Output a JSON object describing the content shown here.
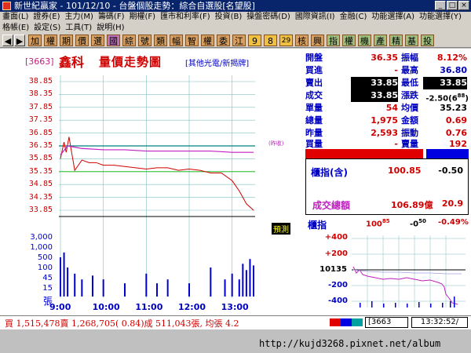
{
  "window": {
    "title": "新世紀贏家 - 101/12/10 - 台盤個股走勢：綜合自選股[名望股]"
  },
  "menu": {
    "row1": [
      "畫面(L)",
      "證券(E)",
      "主力(M)",
      "籌碼(F)",
      "期權(F)",
      "匯市和利率(F)",
      "投資(B)",
      "操盤密碼(D)",
      "國際資訊(I)",
      "金融(C)",
      "功能選擇(A)",
      "功能選擇(Y)"
    ],
    "row2": [
      "格帳(E)",
      "設定(S)",
      "工具(T)",
      "說明(H)"
    ]
  },
  "toolbar": {
    "buttons": [
      "加",
      "權",
      "期",
      "價",
      "選",
      "國",
      "綜",
      "號",
      "類",
      "幅",
      "智",
      "權",
      "委",
      "江",
      "9",
      "8",
      "29",
      "核",
      "興",
      "指",
      "權",
      "機",
      "產",
      "精",
      "基",
      "投"
    ],
    "selected_index": 5
  },
  "stock": {
    "code": "[3663]",
    "name": "鑫科",
    "chart_title": "量價走勢圖",
    "industry": "[其他光電/新揭牌]"
  },
  "quote": {
    "open_label": "開盤",
    "open": "36.35",
    "range_label": "振幅",
    "range": "8.12%",
    "buy_label": "買進",
    "buy": "-",
    "high_label": "最高",
    "high": "36.80",
    "sell_label": "賣出",
    "sell": "33.85",
    "low_label": "最低",
    "low": "33.85",
    "deal_label": "成交",
    "deal": "33.85",
    "change_label": "漲跌",
    "change": "-2.50(6",
    "change_sup": "88",
    "change_tail": ")",
    "vol_label": "單量",
    "vol": "54",
    "avg_label": "均價",
    "avg": "35.23",
    "total_label": "總量",
    "total": "1,975",
    "amount_label": "金額",
    "amount": "0.69",
    "yvol_label": "昨量",
    "yvol": "2,593",
    "turn_label": "振動",
    "turn": "0.76",
    "bvol_label": "買量",
    "bvol": "-",
    "svol_label": "賣量",
    "svol": "192"
  },
  "index_box": {
    "label": "櫃指(含)",
    "value": "100.85",
    "change": "-0.50",
    "total_label": "成交總額",
    "total_value": "106.89億",
    "total_change": "20.9"
  },
  "mini_index": {
    "label": "櫃指",
    "value": "100",
    "value_sub": "85",
    "change": "-0",
    "change_sub": "50",
    "pct": "-0.49%",
    "ylabels": [
      "+400",
      "+200",
      "101",
      "35",
      "-200",
      "-400"
    ]
  },
  "labels": {
    "ref_note": "(昨收)",
    "yesterday_badge": "預測"
  },
  "status": {
    "text": "買 1,515,478賣 1,268,705( 0.84)成 511,043張, 均張 4.2",
    "code": "[3663",
    "time": "13:32:52/"
  },
  "url": "http://kujd3268.pixnet.net/album",
  "colors": {
    "price_line": "#d00000",
    "avg_line": "#c020c0",
    "ref_line": "#008080",
    "volume_bar": "#0000d0",
    "grid": "#80c0c0"
  },
  "chart_data": {
    "type": "line",
    "title": "量價走勢圖",
    "y_price_ticks": [
      "38.85",
      "38.35",
      "37.85",
      "37.35",
      "36.85",
      "36.35",
      "35.85",
      "35.35",
      "34.85",
      "34.35",
      "33.85"
    ],
    "y_volume_ticks": [
      "3,000",
      "1,000",
      "500",
      "100",
      "45",
      "15",
      "張"
    ],
    "x_ticks": [
      "9:00",
      "10:00",
      "11:00",
      "12:00",
      "13:00"
    ],
    "ylim": [
      33.85,
      38.85
    ],
    "reference_price": 36.35,
    "series": [
      {
        "name": "price",
        "x": [
          "9:00",
          "9:05",
          "9:08",
          "9:12",
          "9:15",
          "9:20",
          "9:25",
          "9:30",
          "9:40",
          "9:50",
          "10:00",
          "10:15",
          "10:30",
          "10:45",
          "11:00",
          "11:15",
          "11:30",
          "11:45",
          "12:00",
          "12:15",
          "12:30",
          "12:45",
          "13:00",
          "13:10",
          "13:20",
          "13:30"
        ],
        "values": [
          35.85,
          36.5,
          36.1,
          36.7,
          36.2,
          35.4,
          35.6,
          35.8,
          35.7,
          35.7,
          35.6,
          35.6,
          35.55,
          35.5,
          35.45,
          35.5,
          35.5,
          35.4,
          35.45,
          35.4,
          35.3,
          35.3,
          35.0,
          34.6,
          34.1,
          33.85
        ]
      },
      {
        "name": "average",
        "x": [
          "9:00",
          "9:10",
          "9:20",
          "9:30",
          "10:00",
          "10:30",
          "11:00",
          "11:30",
          "12:00",
          "12:30",
          "13:00",
          "13:30"
        ],
        "values": [
          36.0,
          36.35,
          36.3,
          36.25,
          36.2,
          36.2,
          36.15,
          36.15,
          36.15,
          36.15,
          36.1,
          36.1
        ]
      },
      {
        "name": "volume",
        "x": [
          "9:00",
          "9:05",
          "9:10",
          "9:20",
          "9:30",
          "9:45",
          "10:00",
          "10:30",
          "11:00",
          "11:15",
          "11:30",
          "12:00",
          "12:30",
          "12:50",
          "13:00",
          "13:10",
          "13:15",
          "13:20",
          "13:25",
          "13:30"
        ],
        "values": [
          60,
          100,
          20,
          10,
          5,
          8,
          5,
          3,
          10,
          3,
          5,
          3,
          20,
          5,
          10,
          5,
          30,
          15,
          50,
          25
        ]
      }
    ]
  }
}
